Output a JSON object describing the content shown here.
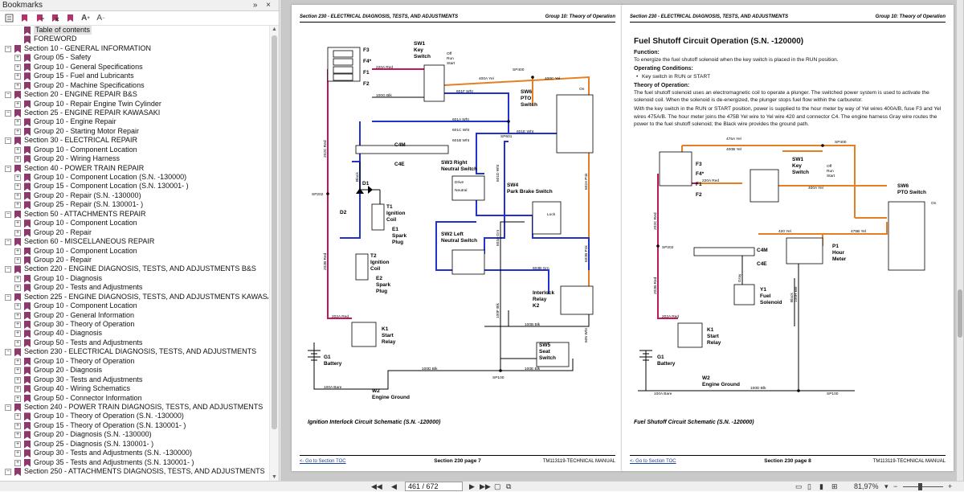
{
  "panel": {
    "title": "Bookmarks",
    "controls": "» ×"
  },
  "bookmarks": [
    {
      "label": "Table of contents",
      "level": 1,
      "toggle": "",
      "selected": true
    },
    {
      "label": "FOREWORD",
      "level": 1,
      "toggle": ""
    },
    {
      "label": "Section 10 - GENERAL INFORMATION",
      "level": 0,
      "toggle": "−"
    },
    {
      "label": "Group 05 - Safety",
      "level": 1,
      "toggle": "+"
    },
    {
      "label": "Group 10 - General Specifications",
      "level": 1,
      "toggle": "+"
    },
    {
      "label": "Group 15 - Fuel and Lubricants",
      "level": 1,
      "toggle": "+"
    },
    {
      "label": "Group 20 - Machine Specifications",
      "level": 1,
      "toggle": "+"
    },
    {
      "label": "Section 20 - ENGINE REPAIR B&S",
      "level": 0,
      "toggle": "−"
    },
    {
      "label": "Group 10 - Repair Engine Twin Cylinder",
      "level": 1,
      "toggle": "+"
    },
    {
      "label": "Section 25 - ENGINE REPAIR KAWASAKI",
      "level": 0,
      "toggle": "−"
    },
    {
      "label": "Group 10 - Engine Repair",
      "level": 1,
      "toggle": "+"
    },
    {
      "label": "Group 20 - Starting Motor Repair",
      "level": 1,
      "toggle": "+"
    },
    {
      "label": "Section 30 - ELECTRICAL REPAIR",
      "level": 0,
      "toggle": "−"
    },
    {
      "label": "Group 10 - Component Location",
      "level": 1,
      "toggle": "+"
    },
    {
      "label": "Group 20 - Wiring Harness",
      "level": 1,
      "toggle": "+"
    },
    {
      "label": "Section 40 - POWER TRAIN REPAIR",
      "level": 0,
      "toggle": "−"
    },
    {
      "label": "Group 10 - Component Location (S.N. -130000)",
      "level": 1,
      "toggle": "+"
    },
    {
      "label": "Group 15 - Component Location (S.N. 130001- )",
      "level": 1,
      "toggle": "+"
    },
    {
      "label": "Group 20 - Repair (S.N. -130000)",
      "level": 1,
      "toggle": "+"
    },
    {
      "label": "Group 25 - Repair (S.N. 130001- )",
      "level": 1,
      "toggle": "+"
    },
    {
      "label": "Section 50 - ATTACHMENTS REPAIR",
      "level": 0,
      "toggle": "−"
    },
    {
      "label": "Group 10 - Component Location",
      "level": 1,
      "toggle": "+"
    },
    {
      "label": "Group 20 - Repair",
      "level": 1,
      "toggle": "+"
    },
    {
      "label": "Section 60 - MISCELLANEOUS REPAIR",
      "level": 0,
      "toggle": "−"
    },
    {
      "label": "Group 10 - Component Location",
      "level": 1,
      "toggle": "+"
    },
    {
      "label": "Group 20 - Repair",
      "level": 1,
      "toggle": "+"
    },
    {
      "label": "Section 220 - ENGINE DIAGNOSIS, TESTS, AND ADJUSTMENTS B&S",
      "level": 0,
      "toggle": "−"
    },
    {
      "label": "Group 10 - Diagnosis",
      "level": 1,
      "toggle": "+"
    },
    {
      "label": "Group 20 - Tests and Adjustments",
      "level": 1,
      "toggle": "+"
    },
    {
      "label": "Section 225 - ENGINE DIAGNOSIS, TESTS, AND ADJUSTMENTS KAWASAKI",
      "level": 0,
      "toggle": "−"
    },
    {
      "label": "Group 10 - Component Location",
      "level": 1,
      "toggle": "+"
    },
    {
      "label": "Group 20 - General Information",
      "level": 1,
      "toggle": "+"
    },
    {
      "label": "Group 30 - Theory of Operation",
      "level": 1,
      "toggle": "+"
    },
    {
      "label": "Group 40 - Diagnosis",
      "level": 1,
      "toggle": "+"
    },
    {
      "label": "Group 50 - Tests and Adjustments",
      "level": 1,
      "toggle": "+"
    },
    {
      "label": "Section 230 - ELECTRICAL DIAGNOSIS, TESTS, AND ADJUSTMENTS",
      "level": 0,
      "toggle": "−"
    },
    {
      "label": "Group 10 - Theory of Operation",
      "level": 1,
      "toggle": "+"
    },
    {
      "label": "Group 20 - Diagnosis",
      "level": 1,
      "toggle": "+"
    },
    {
      "label": "Group 30 - Tests and Adjustments",
      "level": 1,
      "toggle": "+"
    },
    {
      "label": "Group 40 - Wiring Schematics",
      "level": 1,
      "toggle": "+"
    },
    {
      "label": "Group 50 - Connector Information",
      "level": 1,
      "toggle": "+"
    },
    {
      "label": "Section 240 - POWER TRAIN DIAGNOSIS, TESTS, AND ADJUSTMENTS",
      "level": 0,
      "toggle": "−"
    },
    {
      "label": "Group 10 - Theory of Operation (S.N. -130000)",
      "level": 1,
      "toggle": "+"
    },
    {
      "label": "Group 15 - Theory of Operation (S.N. 130001- )",
      "level": 1,
      "toggle": "+"
    },
    {
      "label": "Group 20 - Diagnosis (S.N. -130000)",
      "level": 1,
      "toggle": "+"
    },
    {
      "label": "Group 25 - Diagnosis (S.N. 130001- )",
      "level": 1,
      "toggle": "+"
    },
    {
      "label": "Group 30 - Tests and Adjustments (S.N. -130000)",
      "level": 1,
      "toggle": "+"
    },
    {
      "label": "Group 35 - Tests and Adjustments (S.N. 130001- )",
      "level": 1,
      "toggle": "+"
    },
    {
      "label": "Section 250 - ATTACHMENTS DIAGNOSIS, TESTS, AND ADJUSTMENTS",
      "level": 0,
      "toggle": "−"
    }
  ],
  "page1": {
    "header_left": "Section 230 - ELECTRICAL DIAGNOSIS, TESTS, AND ADJUSTMENTS",
    "header_right": "Group 10: Theory of Operation",
    "caption": "Ignition Interlock Circuit Schematic (S.N. -120000)",
    "footer_link": "<- Go to Section TOC",
    "footer_center": "Section 230 page 7",
    "footer_right": "TM113119-TECHNICAL MANUAL",
    "labels": {
      "f3": "F3",
      "f4": "F4*",
      "f1": "F1",
      "f2": "F2",
      "sw1": "SW1",
      "sw1b": "Key",
      "sw1c": "Switch",
      "sw6": "SW6",
      "sw6b": "PTO",
      "sw6c": "Switch",
      "sw3": "SW3 Right",
      "sw3b": "Neutral Switch",
      "sw4": "SW4",
      "sw4b": "Park Brake Switch",
      "sw2": "SW2 Left",
      "sw2b": "Neutral Switch",
      "sw5": "SW5",
      "sw5b": "Seat",
      "sw5c": "Switch",
      "c4m": "C4M",
      "c4e": "C4E",
      "t1": "T1",
      "t1b": "Ignition",
      "t1c": "Coil",
      "e1": "E1",
      "e1b": "Spark",
      "e1c": "Plug",
      "t2": "T2",
      "t2b": "Ignition",
      "t2c": "Coil",
      "e2": "E2",
      "e2b": "Spark",
      "e2c": "Plug",
      "d1": "D1",
      "d2": "D2",
      "k1": "K1",
      "k1b": "Start",
      "k1c": "Relay",
      "k2": "Interlock",
      "k2b": "Relay",
      "k2c": "K2",
      "g1": "G1",
      "g1b": "Battery",
      "w2": "W2",
      "w2b": "Engine Ground",
      "sp400": "SP400",
      "sp601": "SP601",
      "sp202": "SP202",
      "sp100": "SP100",
      "w220a": "220A Red",
      "w400a": "400A Yel",
      "w400c": "400C Yel",
      "w100g": "100G Blk",
      "w601f": "601F Wht",
      "w601a": "601A Wht",
      "w601c": "601C Wht",
      "w601b": "601B Wht",
      "w601e": "601E Wht",
      "w202a": "202A Red",
      "w100a": "100A Bare",
      "w100d": "100D Blk",
      "w100e": "100E Blk",
      "w100b": "100B Blk",
      "w603b": "603B Grn",
      "w202c": "202C Red",
      "w202b": "202B Red",
      "w601d": "601D Wht",
      "w603a": "603A Grn",
      "w602a": "602A Pnk",
      "w602b": "602B Pnk",
      "w100f": "100F Blk",
      "w605": "605 Wht",
      "black": "Black",
      "off": "Off",
      "run": "Run",
      "start": "Start",
      "on": "On",
      "drive": "Drive",
      "neutral": "Neutral",
      "lock": "Lock"
    }
  },
  "page2": {
    "header_left": "Section 230 - ELECTRICAL DIAGNOSIS, TESTS, AND ADJUSTMENTS",
    "header_right": "Group 10: Theory of Operation",
    "title": "Fuel Shutoff Circuit Operation (S.N. -120000)",
    "function_heading": "Function:",
    "function_text": "To energize the fuel shutoff solenoid when the key switch is placed in the RUN position.",
    "conditions_heading": "Operating Conditions:",
    "condition_item": "Key switch in RUN or START",
    "theory_heading": "Theory of Operation:",
    "theory_p1": "The fuel shutoff solenoid uses an electromagnetic coil to operate a plunger. The switched power system is used to activate the solenoid coil. When the solenoid is de-energized, the plunger stops fuel flow within the carburetor.",
    "theory_p2": "With the key switch in the RUN or START position, power is supplied to the hour meter by way of Yel wires 400A/B, fuse F3 and Yel wires 475A/B. The hour meter joins the 475B Yel wire to Yel wire 420 and connector C4. The engine harness Gray wire routes the power to the fuel shutoff solenoid; the Black wire provides the ground path.",
    "caption": "Fuel Shutoff Circuit Schematic (S.N. -120000)",
    "footer_link": "<- Go to Section TOC",
    "footer_center": "Section 230 page 8",
    "footer_right": "TM113119-TECHNICAL MANUAL",
    "labels": {
      "w475a": "475A Yel",
      "w400b": "400B Yel",
      "sp400": "SP400",
      "f3": "F3",
      "f4": "F4*",
      "f1": "F1",
      "f2": "F2",
      "sw1": "SW1",
      "sw1b": "Key",
      "sw1c": "Switch",
      "sw6": "SW6",
      "sw6b": "PTO Switch",
      "w220a": "220A Red",
      "w400a": "400A Yel",
      "w420": "420 Yel",
      "w475b": "475B Yel",
      "sp202": "SP202",
      "c4m": "C4M",
      "c4e": "C4E",
      "p1": "P1",
      "p1b": "Hour",
      "p1c": "Meter",
      "y1": "Y1",
      "y1b": "Fuel",
      "y1c": "Solenoid",
      "w202a": "202A Red",
      "w202c": "202C Red",
      "w202b": "202B Red",
      "k1": "K1",
      "k1b": "Start",
      "k1c": "Relay",
      "g1": "G1",
      "g1b": "Battery",
      "w2": "W2",
      "w2b": "Engine Ground",
      "w100a": "100A Bare",
      "w100d": "100D Blk",
      "sp100": "SP100",
      "gray": "Gray",
      "black": "Black",
      "w100h": "100H Blk",
      "off": "Off",
      "run": "Run",
      "start": "Start",
      "on": "On"
    }
  },
  "statusbar": {
    "page_input": "461 / 672",
    "zoom": "81,97%",
    "nav_first": "◀◀",
    "nav_prev": "◀",
    "nav_next": "▶",
    "nav_last": "▶▶"
  }
}
